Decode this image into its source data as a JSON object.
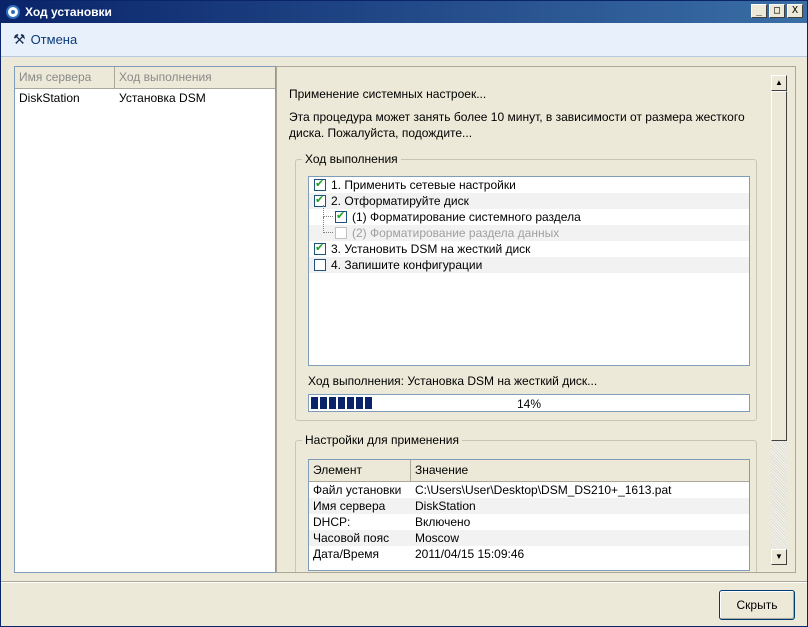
{
  "window": {
    "title": "Ход установки",
    "controls": {
      "minimize": "_",
      "maximize": "□",
      "close": "X"
    }
  },
  "toolbar": {
    "cancel_label": "Отмена",
    "cancel_icon": "tools-icon"
  },
  "servers": {
    "columns": [
      "Имя сервера",
      "Ход выполнения"
    ],
    "rows": [
      {
        "name": "DiskStation",
        "status": "Установка DSM"
      }
    ]
  },
  "status": {
    "line": "Применение системных настроек...",
    "description": "Эта процедура может занять более 10 минут, в зависимости от размера жесткого диска. Пожалуйста, подождите..."
  },
  "progress_group": {
    "title": "Ход выполнения",
    "tasks": [
      {
        "label": "1. Применить сетевые настройки",
        "checked": true,
        "level": 0,
        "disabled": false
      },
      {
        "label": "2. Отформатируйте диск",
        "checked": true,
        "level": 0,
        "disabled": false
      },
      {
        "label": "(1) Форматирование системного раздела",
        "checked": true,
        "level": 1,
        "disabled": false
      },
      {
        "label": "(2) Форматирование раздела данных",
        "checked": false,
        "level": 1,
        "disabled": true
      },
      {
        "label": "3. Установить DSM на жесткий диск",
        "checked": true,
        "level": 0,
        "disabled": false
      },
      {
        "label": "4. Запишите конфигурации",
        "checked": false,
        "level": 0,
        "disabled": false
      }
    ],
    "progress_label": "Ход выполнения: Установка DSM на жесткий диск...",
    "progress_percent": 14,
    "progress_text": "14%"
  },
  "settings_group": {
    "title": "Настройки для применения",
    "columns": [
      "Элемент",
      "Значение"
    ],
    "rows": [
      [
        "Файл установки",
        "C:\\Users\\User\\Desktop\\DSM_DS210+_1613.pat"
      ],
      [
        "Имя сервера",
        "DiskStation"
      ],
      [
        "DHCP:",
        "Включено"
      ],
      [
        "Часовой пояс",
        "Moscow"
      ],
      [
        "Дата/Время",
        "2011/04/15 15:09:46"
      ]
    ]
  },
  "footer": {
    "close_label": "Скрыть"
  },
  "colors": {
    "title_bar": "#0a246a",
    "progress": "#0a246a",
    "check": "#21a121"
  }
}
